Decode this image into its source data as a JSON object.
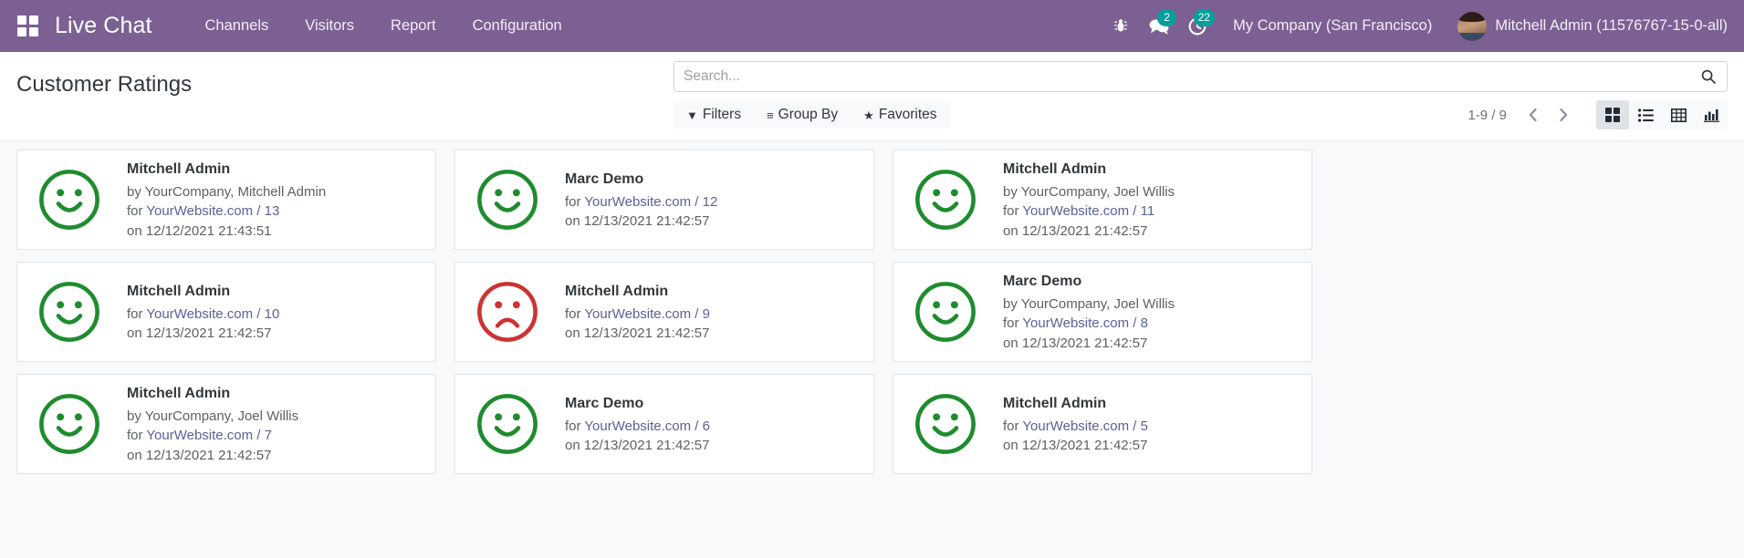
{
  "navbar": {
    "apps_icon": "apps-grid-icon",
    "brand": "Live Chat",
    "menu": [
      {
        "label": "Channels"
      },
      {
        "label": "Visitors"
      },
      {
        "label": "Report"
      },
      {
        "label": "Configuration"
      }
    ],
    "sys_icons": [
      {
        "name": "bug-icon",
        "badge": null
      },
      {
        "name": "messages-icon",
        "badge": "2"
      },
      {
        "name": "activities-clock-icon",
        "badge": "22"
      }
    ],
    "company": "My Company (San Francisco)",
    "user": "Mitchell Admin (11576767-15-0-all)",
    "avatar_icon": "user-avatar"
  },
  "control_panel": {
    "title": "Customer Ratings",
    "search": {
      "placeholder": "Search...",
      "value": "",
      "icon": "search-icon"
    },
    "filters": [
      {
        "label": "Filters",
        "icon": "funnel-icon"
      },
      {
        "label": "Group By",
        "icon": "bars-icon"
      },
      {
        "label": "Favorites",
        "icon": "star-icon"
      }
    ],
    "pager": {
      "count": "1-9 / 9",
      "prev_icon": "chevron-left-icon",
      "next_icon": "chevron-right-icon"
    },
    "views": [
      {
        "name": "kanban",
        "icon": "kanban-icon",
        "active": true
      },
      {
        "name": "list",
        "icon": "list-icon",
        "active": false
      },
      {
        "name": "pivot",
        "icon": "pivot-table-icon",
        "active": false
      },
      {
        "name": "graph",
        "icon": "bar-chart-icon",
        "active": false
      }
    ]
  },
  "colors": {
    "navbar_bg": "#7c6094",
    "badge_bg": "#00a09d",
    "happy_face": "#1e8c2e",
    "sad_face": "#cc3333",
    "link": "#5a6199",
    "body_bg": "#f8f9fa"
  },
  "ratings": [
    {
      "face": "happy",
      "name": "Mitchell Admin",
      "by": "by YourCompany, Mitchell Admin",
      "for_prefix": "for ",
      "for_link": "YourWebsite.com / 13",
      "on": "on 12/12/2021 21:43:51"
    },
    {
      "face": "happy",
      "name": "Marc Demo",
      "by": null,
      "for_prefix": "for ",
      "for_link": "YourWebsite.com / 12",
      "on": "on 12/13/2021 21:42:57"
    },
    {
      "face": "happy",
      "name": "Mitchell Admin",
      "by": "by YourCompany, Joel Willis",
      "for_prefix": "for ",
      "for_link": "YourWebsite.com / 11",
      "on": "on 12/13/2021 21:42:57"
    },
    {
      "face": "happy",
      "name": "Mitchell Admin",
      "by": null,
      "for_prefix": "for ",
      "for_link": "YourWebsite.com / 10",
      "on": "on 12/13/2021 21:42:57"
    },
    {
      "face": "sad",
      "name": "Mitchell Admin",
      "by": null,
      "for_prefix": "for ",
      "for_link": "YourWebsite.com / 9",
      "on": "on 12/13/2021 21:42:57"
    },
    {
      "face": "happy",
      "name": "Marc Demo",
      "by": "by YourCompany, Joel Willis",
      "for_prefix": "for ",
      "for_link": "YourWebsite.com / 8",
      "on": "on 12/13/2021 21:42:57"
    },
    {
      "face": "happy",
      "name": "Mitchell Admin",
      "by": "by YourCompany, Joel Willis",
      "for_prefix": "for ",
      "for_link": "YourWebsite.com / 7",
      "on": "on 12/13/2021 21:42:57"
    },
    {
      "face": "happy",
      "name": "Marc Demo",
      "by": null,
      "for_prefix": "for ",
      "for_link": "YourWebsite.com / 6",
      "on": "on 12/13/2021 21:42:57"
    },
    {
      "face": "happy",
      "name": "Mitchell Admin",
      "by": null,
      "for_prefix": "for ",
      "for_link": "YourWebsite.com / 5",
      "on": "on 12/13/2021 21:42:57"
    }
  ]
}
